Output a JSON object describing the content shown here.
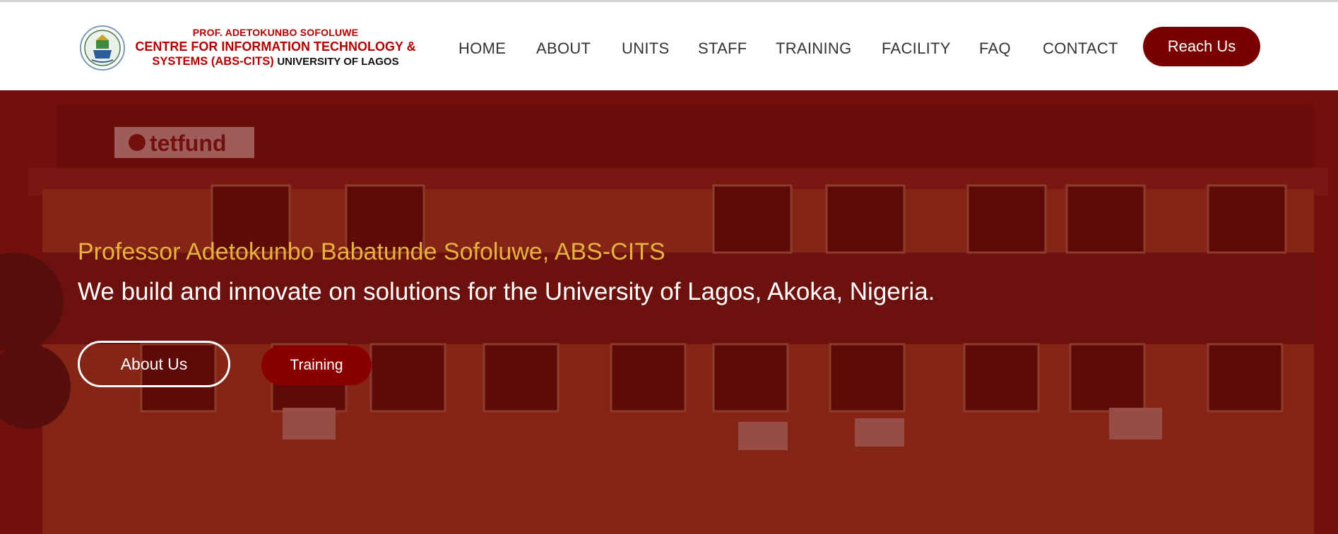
{
  "header": {
    "logo": {
      "line1": "PROF. ADETOKUNBO SOFOLUWE",
      "line2": "CENTRE FOR INFORMATION TECHNOLOGY &",
      "line3_red": "SYSTEMS (ABS-CITS)",
      "line3_black": "UNIVERSITY OF LAGOS",
      "icon": "university-seal"
    },
    "nav": [
      {
        "label": "HOME"
      },
      {
        "label": "ABOUT"
      },
      {
        "label": "UNITS"
      },
      {
        "label": "STAFF"
      },
      {
        "label": "TRAINING"
      },
      {
        "label": "FACILITY"
      },
      {
        "label": "FAQ"
      },
      {
        "label": "CONTACT"
      }
    ],
    "cta_label": "Reach Us"
  },
  "hero": {
    "tagline": "Professor Adetokunbo Babatunde Sofoluwe, ABS-CITS",
    "headline": "We build and innovate on solutions for the University of Lagos, Akoka, Nigeria.",
    "sign_text": "tetfund",
    "primary_button": "About Us",
    "secondary_button": "Training"
  },
  "colors": {
    "brand_red": "#7a0000",
    "gold": "#e6b43c",
    "nav_text": "#333333"
  }
}
